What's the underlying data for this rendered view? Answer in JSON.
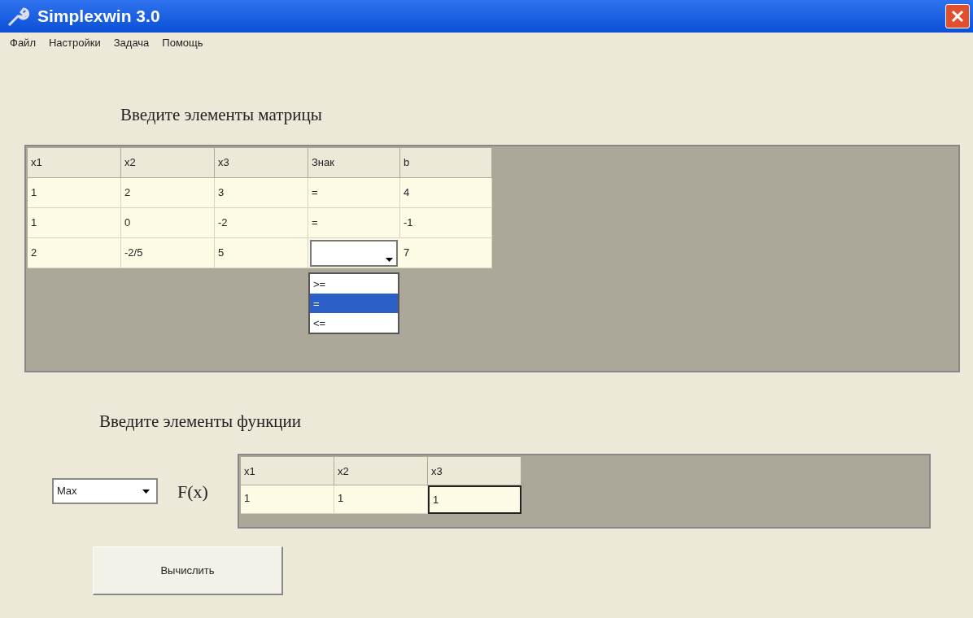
{
  "window": {
    "title": "Simplexwin 3.0"
  },
  "menu": [
    "Файл",
    "Настройки",
    "Задача",
    "Помощь"
  ],
  "matrix": {
    "heading": "Введите элементы матрицы",
    "columns": [
      "x1",
      "x2",
      "x3",
      "Знак",
      "b"
    ],
    "rows": [
      [
        {
          "kind": "text",
          "value": "1"
        },
        {
          "kind": "text",
          "value": "2"
        },
        {
          "kind": "text",
          "value": "3"
        },
        {
          "kind": "text",
          "value": "="
        },
        {
          "kind": "text",
          "value": "4"
        }
      ],
      [
        {
          "kind": "text",
          "value": "1"
        },
        {
          "kind": "text",
          "value": "0"
        },
        {
          "kind": "text",
          "value": "-2"
        },
        {
          "kind": "text",
          "value": "="
        },
        {
          "kind": "text",
          "value": "-1"
        }
      ],
      [
        {
          "kind": "text",
          "value": "2"
        },
        {
          "kind": "text",
          "value": "-2/5"
        },
        {
          "kind": "text",
          "value": "5"
        },
        {
          "kind": "combo",
          "options": [
            {
              "label": ">=",
              "selected": false
            },
            {
              "label": "=",
              "selected": true
            },
            {
              "label": "<=",
              "selected": false
            }
          ]
        },
        {
          "kind": "text",
          "value": "7"
        }
      ]
    ]
  },
  "function": {
    "heading": "Введите элементы функции",
    "goal": "Max",
    "label": "F(x)",
    "columns": [
      "x1",
      "x2",
      "x3"
    ],
    "values": [
      {
        "value": "1",
        "focused": false
      },
      {
        "value": "1",
        "focused": false
      },
      {
        "value": "1",
        "focused": true
      }
    ]
  },
  "button": "Вычислить"
}
